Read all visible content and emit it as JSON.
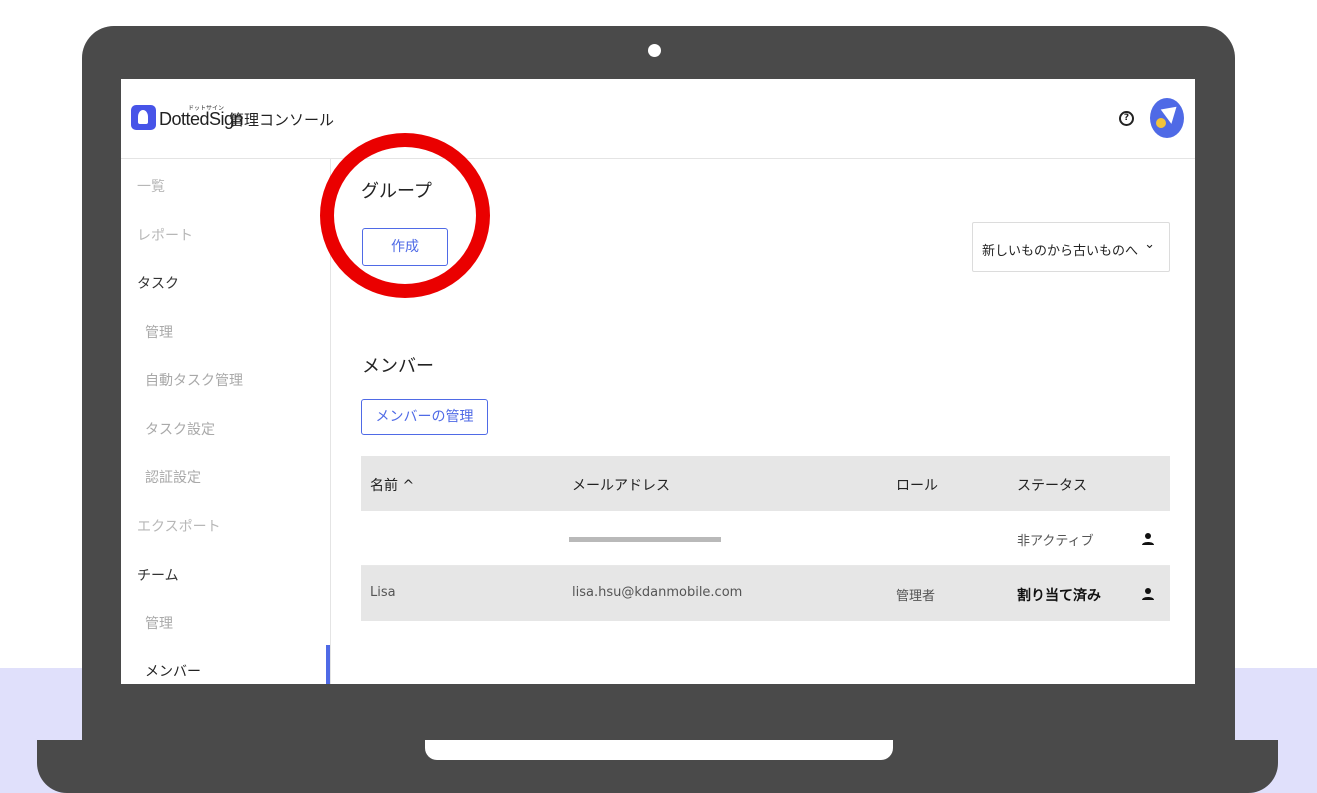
{
  "app": {
    "logo_kana": "ドットサイン",
    "logo_text": "DottedSign",
    "console_title": "管理コンソール",
    "help_glyph": "?"
  },
  "sidebar": {
    "items": [
      {
        "label": "一覧",
        "style": "muted"
      },
      {
        "label": "レポート",
        "style": "muted"
      },
      {
        "label": "タスク",
        "style": "dark"
      },
      {
        "label": "管理",
        "style": "sub"
      },
      {
        "label": "自動タスク管理",
        "style": "sub"
      },
      {
        "label": "タスク設定",
        "style": "sub"
      },
      {
        "label": "認証設定",
        "style": "sub"
      },
      {
        "label": "エクスポート",
        "style": "muted"
      },
      {
        "label": "チーム",
        "style": "dark"
      },
      {
        "label": "管理",
        "style": "sub"
      },
      {
        "label": "メンバー",
        "style": "active"
      }
    ]
  },
  "main": {
    "group_title": "グループ",
    "create_button": "作成",
    "sort_select": {
      "selected": "新しいものから古いものへ",
      "chevron": "⌄"
    },
    "members_title": "メンバー",
    "manage_members_button": "メンバーの管理",
    "table": {
      "headers": {
        "name": "名前 ^",
        "email": "メールアドレス",
        "role": "ロール",
        "status": "ステータス"
      },
      "rows": [
        {
          "name": "",
          "email": "",
          "role": "",
          "status": "非アクティブ"
        },
        {
          "name": "Lisa",
          "email": "lisa.hsu@kdanmobile.com",
          "role": "管理者",
          "status": "割り当て済み"
        }
      ]
    }
  },
  "colors": {
    "accent": "#4f6ae6",
    "highlight_circle": "#ea0000",
    "laptop_body": "#4a4a4a",
    "background_band": "#e0e0fb"
  }
}
